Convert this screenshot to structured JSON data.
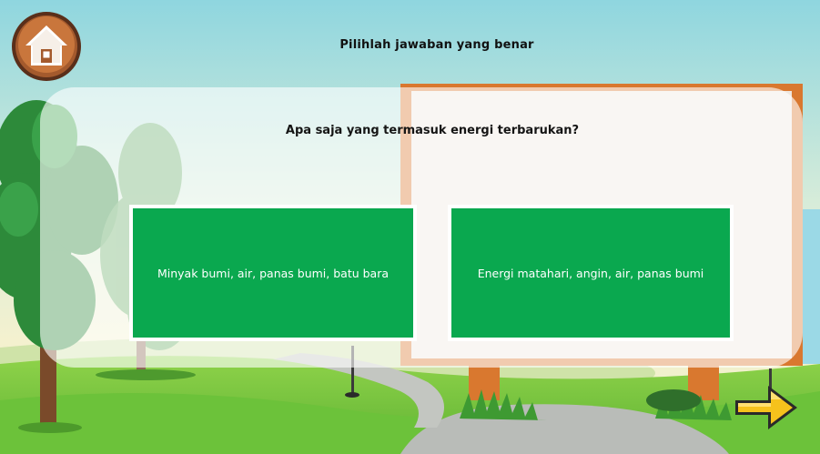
{
  "header": {
    "instruction": "Pilihlah jawaban yang benar"
  },
  "quiz": {
    "question": "Apa saja yang termasuk energi terbarukan?",
    "answers": [
      {
        "label": "Minyak bumi, air, panas bumi, batu bara"
      },
      {
        "label": "Energi matahari, angin, air, panas bumi"
      }
    ]
  },
  "icons": {
    "home": "home-icon",
    "next": "arrow-right-icon"
  },
  "colors": {
    "answer_bg": "#0aa84f",
    "answer_border": "#ffffff",
    "board_frame": "#d9782f",
    "next_arrow": "#f6c21c"
  }
}
